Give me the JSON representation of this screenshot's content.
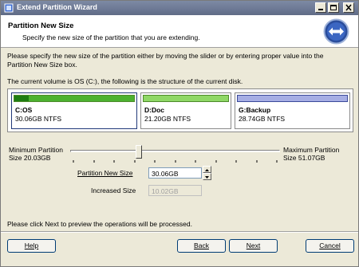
{
  "window": {
    "title": "Extend Partition Wizard"
  },
  "header": {
    "title": "Partition New Size",
    "subtitle": "Specify the new size of the partition that you are extending."
  },
  "description": {
    "line1": "Please specify the new size of the partition either by moving the slider or by entering proper value into the",
    "line2": "Partition New Size box.",
    "structure": "The current volume is OS (C:), the following is the structure of the current disk."
  },
  "partitions": [
    {
      "name": "C:OS",
      "info": "30.06GB NTFS",
      "bar_color": "#4cb230",
      "fill": 0.12,
      "selected": true
    },
    {
      "name": "D:Doc",
      "info": "21.20GB NTFS",
      "bar_color": "#8fd866",
      "fill": 0.0,
      "selected": false
    },
    {
      "name": "G:Backup",
      "info": "28.74GB NTFS",
      "bar_color": "#a6aee4",
      "fill": 0.0,
      "selected": false
    }
  ],
  "slider": {
    "min_label_1": "Minimum Partition",
    "min_label_2": "Size 20.03GB",
    "max_label_1": "Maximum Partition",
    "max_label_2": "Size 51.07GB",
    "position": 0.32
  },
  "fields": {
    "new_size_label": "Partition New Size",
    "new_size_value": "30.06GB",
    "increased_label": "Increased Size",
    "increased_value": "10.02GB"
  },
  "footer": {
    "note": "Please click Next to preview the operations will be processed."
  },
  "buttons": {
    "help": "Help",
    "back": "Back",
    "next": "Next",
    "cancel": "Cancel"
  }
}
